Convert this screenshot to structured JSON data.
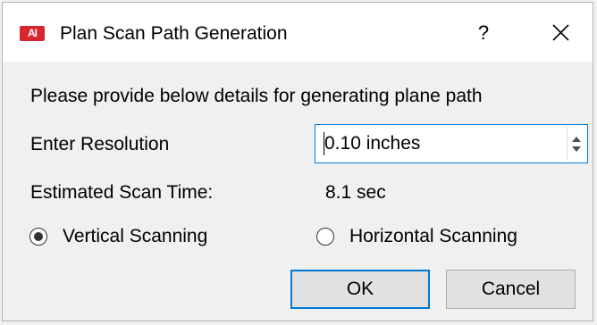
{
  "window": {
    "title": "Plan Scan Path Generation",
    "logo_text": "AI",
    "help_label": "?",
    "close_icon": "close-icon"
  },
  "form": {
    "prompt": "Please provide below details for generating plane path",
    "resolution_label": "Enter Resolution",
    "resolution_value": "0.10 inches",
    "estimated_label": "Estimated Scan Time:",
    "estimated_value": "8.1 sec"
  },
  "scanning": {
    "options": [
      {
        "label": "Vertical Scanning",
        "checked": true
      },
      {
        "label": "Horizontal Scanning",
        "checked": false
      }
    ]
  },
  "buttons": {
    "ok_label": "OK",
    "cancel_label": "Cancel"
  },
  "colors": {
    "accent": "#0078d7",
    "logo": "#d9262e"
  }
}
